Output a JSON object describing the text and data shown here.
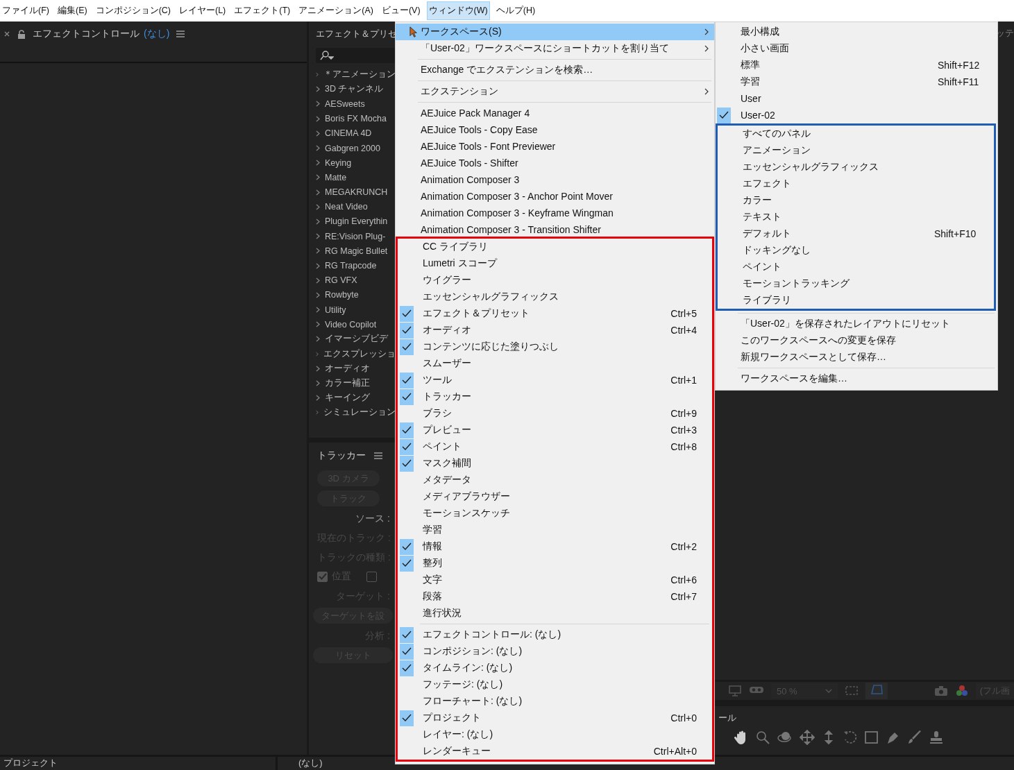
{
  "menu_bar": [
    {
      "label": "ファイル(F)",
      "selected": false
    },
    {
      "label": "編集(E)",
      "selected": false
    },
    {
      "label": "コンポジション(C)",
      "selected": false
    },
    {
      "label": "レイヤー(L)",
      "selected": false
    },
    {
      "label": "エフェクト(T)",
      "selected": false
    },
    {
      "label": "アニメーション(A)",
      "selected": false
    },
    {
      "label": "ビュー(V)",
      "selected": false
    },
    {
      "label": "ウィンドウ(W)",
      "selected": true
    },
    {
      "label": "ヘルプ(H)",
      "selected": false
    }
  ],
  "effect_controls": {
    "title": "エフェクトコントロール",
    "subject": "(なし)"
  },
  "effects_presets": {
    "title": "エフェクト＆プリセ",
    "categories": [
      "＊アニメーション",
      "3D チャンネル",
      "AESweets",
      "Boris FX Mocha",
      "CINEMA 4D",
      "Gabgren 2000",
      "Keying",
      "Matte",
      "MEGAKRUNCH",
      "Neat Video",
      "Plugin Everythin",
      "RE:Vision Plug-",
      "RG Magic Bullet",
      "RG Trapcode",
      "RG VFX",
      "Rowbyte",
      "Utility",
      "Video Copilot",
      "イマーシブビデ",
      "エクスプレッショ",
      "オーディオ",
      "カラー補正",
      "キーイング",
      "シミュレーション"
    ]
  },
  "tracker": {
    "title": "トラッカー",
    "buttons": [
      "3D カメラ",
      "トラック"
    ],
    "rows": [
      {
        "kind": "label",
        "text": "ソース :",
        "disabled": false
      },
      {
        "kind": "label",
        "text": "現在のトラック :",
        "disabled": true
      },
      {
        "kind": "label",
        "text": "トラックの種類 :",
        "disabled": true
      },
      {
        "kind": "checkboxes",
        "boxes": [
          {
            "label": "位置",
            "checked": true
          },
          {
            "checked": false
          }
        ]
      },
      {
        "kind": "label",
        "text": "ターゲット :",
        "disabled": true
      },
      {
        "kind": "button",
        "text": "ターゲットを設"
      },
      {
        "kind": "label",
        "text": "分析 :",
        "disabled": true
      },
      {
        "kind": "button",
        "text": "リセット"
      }
    ]
  },
  "top_right_tab": "ッテ",
  "viewer": {
    "zoom": "50 %",
    "resolution": "(フル画"
  },
  "tools_panel": {
    "title": "ール"
  },
  "bottom_panels": [
    {
      "title": "プロジェクト"
    },
    {
      "title": "(なし)"
    }
  ],
  "window_menu": {
    "sections": [
      {
        "items": [
          {
            "kind": "item",
            "label": "ワークスペース(S)",
            "checked": false,
            "highlighted": true,
            "submenu": true
          },
          {
            "kind": "item",
            "label": "「User-02」ワークスペースにショートカットを割り当て",
            "checked": false,
            "highlighted": false,
            "submenu": true
          },
          {
            "kind": "separator"
          },
          {
            "kind": "item",
            "label": "Exchange でエクステンションを検索…",
            "checked": false,
            "highlighted": false,
            "submenu": false
          },
          {
            "kind": "separator"
          },
          {
            "kind": "item",
            "label": "エクステンション",
            "checked": false,
            "highlighted": false,
            "submenu": true
          },
          {
            "kind": "separator"
          },
          {
            "kind": "item",
            "label": "AEJuice Pack Manager 4",
            "checked": false,
            "highlighted": false,
            "submenu": false
          },
          {
            "kind": "item",
            "label": "AEJuice Tools - Copy Ease",
            "checked": false,
            "highlighted": false,
            "submenu": false
          },
          {
            "kind": "item",
            "label": "AEJuice Tools - Font Previewer",
            "checked": false,
            "highlighted": false,
            "submenu": false
          },
          {
            "kind": "item",
            "label": "AEJuice Tools - Shifter",
            "checked": false,
            "highlighted": false,
            "submenu": false
          },
          {
            "kind": "item",
            "label": "Animation Composer 3",
            "checked": false,
            "highlighted": false,
            "submenu": false
          },
          {
            "kind": "item",
            "label": "Animation Composer 3 - Anchor Point Mover",
            "checked": false,
            "highlighted": false,
            "submenu": false
          },
          {
            "kind": "item",
            "label": "Animation Composer 3 - Keyframe Wingman",
            "checked": false,
            "highlighted": false,
            "submenu": false
          },
          {
            "kind": "item",
            "label": "Animation Composer 3 - Transition Shifter",
            "checked": false,
            "highlighted": false,
            "submenu": false
          }
        ]
      },
      {
        "color": "#e8000b",
        "items": [
          {
            "kind": "item",
            "label": "CC ライブラリ",
            "checked": false,
            "highlighted": false,
            "submenu": false
          },
          {
            "kind": "item",
            "label": "Lumetri スコープ",
            "checked": false,
            "highlighted": false,
            "submenu": false
          },
          {
            "kind": "item",
            "label": "ウイグラー",
            "checked": false,
            "highlighted": false,
            "submenu": false
          },
          {
            "kind": "item",
            "label": "エッセンシャルグラフィックス",
            "checked": false,
            "highlighted": false,
            "submenu": false
          },
          {
            "kind": "item",
            "label": "エフェクト＆プリセット",
            "shortcut": "Ctrl+5",
            "checked": true,
            "highlighted": false,
            "submenu": false
          },
          {
            "kind": "item",
            "label": "オーディオ",
            "shortcut": "Ctrl+4",
            "checked": true,
            "highlighted": false,
            "submenu": false
          },
          {
            "kind": "item",
            "label": "コンテンツに応じた塗りつぶし",
            "checked": true,
            "highlighted": false,
            "submenu": false
          },
          {
            "kind": "item",
            "label": "スムーザー",
            "checked": false,
            "highlighted": false,
            "submenu": false
          },
          {
            "kind": "item",
            "label": "ツール",
            "shortcut": "Ctrl+1",
            "checked": true,
            "highlighted": false,
            "submenu": false
          },
          {
            "kind": "item",
            "label": "トラッカー",
            "checked": true,
            "highlighted": false,
            "submenu": false
          },
          {
            "kind": "item",
            "label": "ブラシ",
            "shortcut": "Ctrl+9",
            "checked": false,
            "highlighted": false,
            "submenu": false
          },
          {
            "kind": "item",
            "label": "プレビュー",
            "shortcut": "Ctrl+3",
            "checked": true,
            "highlighted": false,
            "submenu": false
          },
          {
            "kind": "item",
            "label": "ペイント",
            "shortcut": "Ctrl+8",
            "checked": true,
            "highlighted": false,
            "submenu": false
          },
          {
            "kind": "item",
            "label": "マスク補間",
            "checked": true,
            "highlighted": false,
            "submenu": false
          },
          {
            "kind": "item",
            "label": "メタデータ",
            "checked": false,
            "highlighted": false,
            "submenu": false
          },
          {
            "kind": "item",
            "label": "メディアブラウザー",
            "checked": false,
            "highlighted": false,
            "submenu": false
          },
          {
            "kind": "item",
            "label": "モーションスケッチ",
            "checked": false,
            "highlighted": false,
            "submenu": false
          },
          {
            "kind": "item",
            "label": "学習",
            "checked": false,
            "highlighted": false,
            "submenu": false
          },
          {
            "kind": "item",
            "label": "情報",
            "shortcut": "Ctrl+2",
            "checked": true,
            "highlighted": false,
            "submenu": false
          },
          {
            "kind": "item",
            "label": "整列",
            "checked": true,
            "highlighted": false,
            "submenu": false
          },
          {
            "kind": "item",
            "label": "文字",
            "shortcut": "Ctrl+6",
            "checked": false,
            "highlighted": false,
            "submenu": false
          },
          {
            "kind": "item",
            "label": "段落",
            "shortcut": "Ctrl+7",
            "checked": false,
            "highlighted": false,
            "submenu": false
          },
          {
            "kind": "item",
            "label": "進行状況",
            "checked": false,
            "highlighted": false,
            "submenu": false
          },
          {
            "kind": "separator"
          },
          {
            "kind": "item",
            "label": "エフェクトコントロール: (なし)",
            "checked": true,
            "highlighted": false,
            "submenu": false
          },
          {
            "kind": "item",
            "label": "コンポジション: (なし)",
            "checked": true,
            "highlighted": false,
            "submenu": false
          },
          {
            "kind": "item",
            "label": "タイムライン: (なし)",
            "checked": true,
            "highlighted": false,
            "submenu": false
          },
          {
            "kind": "item",
            "label": "フッテージ: (なし)",
            "checked": false,
            "highlighted": false,
            "submenu": false
          },
          {
            "kind": "item",
            "label": "フローチャート: (なし)",
            "checked": false,
            "highlighted": false,
            "submenu": false
          },
          {
            "kind": "item",
            "label": "プロジェクト",
            "shortcut": "Ctrl+0",
            "checked": true,
            "highlighted": false,
            "submenu": false
          },
          {
            "kind": "item",
            "label": "レイヤー: (なし)",
            "checked": false,
            "highlighted": false,
            "submenu": false
          },
          {
            "kind": "item",
            "label": "レンダーキュー",
            "shortcut": "Ctrl+Alt+0",
            "checked": false,
            "highlighted": false,
            "submenu": false
          }
        ]
      }
    ]
  },
  "workspace_menu": {
    "sections": [
      {
        "items": [
          {
            "kind": "item",
            "label": "最小構成",
            "checked": false
          },
          {
            "kind": "item",
            "label": "小さい画面",
            "checked": false
          },
          {
            "kind": "item",
            "label": "標準",
            "shortcut": "Shift+F12",
            "checked": false
          },
          {
            "kind": "item",
            "label": "学習",
            "shortcut": "Shift+F11",
            "checked": false
          },
          {
            "kind": "item",
            "label": "User",
            "checked": false
          },
          {
            "kind": "item",
            "label": "User-02",
            "checked": true
          }
        ]
      },
      {
        "color": "#1f5db4",
        "items": [
          {
            "kind": "item",
            "label": "すべてのパネル",
            "checked": false
          },
          {
            "kind": "item",
            "label": "アニメーション",
            "checked": false
          },
          {
            "kind": "item",
            "label": "エッセンシャルグラフィックス",
            "checked": false
          },
          {
            "kind": "item",
            "label": "エフェクト",
            "checked": false
          },
          {
            "kind": "item",
            "label": "カラー",
            "checked": false
          },
          {
            "kind": "item",
            "label": "テキスト",
            "checked": false
          },
          {
            "kind": "item",
            "label": "デフォルト",
            "shortcut": "Shift+F10",
            "checked": false
          },
          {
            "kind": "item",
            "label": "ドッキングなし",
            "checked": false
          },
          {
            "kind": "item",
            "label": "ペイント",
            "checked": false
          },
          {
            "kind": "item",
            "label": "モーショントラッキング",
            "checked": false
          },
          {
            "kind": "item",
            "label": "ライブラリ",
            "checked": false
          }
        ]
      },
      {
        "items": [
          {
            "kind": "separator"
          },
          {
            "kind": "item",
            "label": "「User-02」を保存されたレイアウトにリセット",
            "checked": false
          },
          {
            "kind": "item",
            "label": "このワークスペースへの変更を保存",
            "checked": false
          },
          {
            "kind": "item",
            "label": "新規ワークスペースとして保存…",
            "checked": false
          },
          {
            "kind": "separator"
          },
          {
            "kind": "item",
            "label": "ワークスペースを編集…",
            "checked": false
          }
        ]
      }
    ]
  }
}
